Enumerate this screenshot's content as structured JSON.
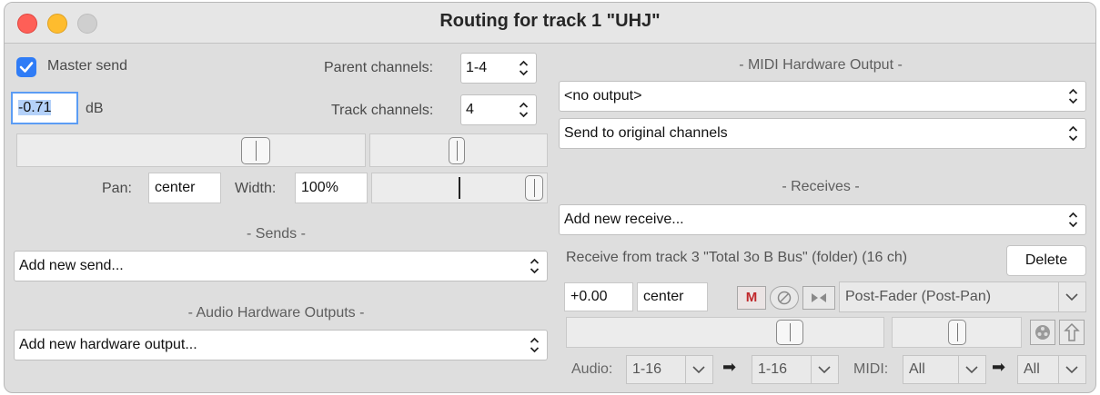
{
  "window": {
    "title": "Routing for track 1 \"UHJ\""
  },
  "left": {
    "master_send_label": "Master send",
    "master_send_checked": true,
    "volume_value": "-0.71",
    "volume_unit": "dB",
    "parent_channels_label": "Parent channels:",
    "parent_channels_value": "1-4",
    "track_channels_label": "Track channels:",
    "track_channels_value": "4",
    "pan_label": "Pan:",
    "pan_value": "center",
    "width_label": "Width:",
    "width_value": "100%",
    "sends_header": "- Sends -",
    "add_send": "Add new send...",
    "audio_hw_header": "- Audio Hardware Outputs -",
    "add_hw_output": "Add new hardware output..."
  },
  "right": {
    "midi_hw_header": "- MIDI Hardware Output -",
    "midi_output": "<no output>",
    "midi_channels": "Send to original channels",
    "receives_header": "- Receives -",
    "add_receive": "Add new receive...",
    "receive": {
      "description": "Receive from track 3 \"Total 3o B Bus\" (folder) (16 ch)",
      "delete_label": "Delete",
      "volume": "+0.00",
      "pan": "center",
      "mute_label": "M",
      "mode": "Post-Fader (Post-Pan)",
      "audio_label": "Audio:",
      "audio_src": "1-16",
      "audio_dst": "1-16",
      "midi_label": "MIDI:",
      "midi_src": "All",
      "midi_dst": "All"
    }
  },
  "colors": {
    "accent": "#2f7cf6",
    "mute_red": "#c0282b"
  }
}
